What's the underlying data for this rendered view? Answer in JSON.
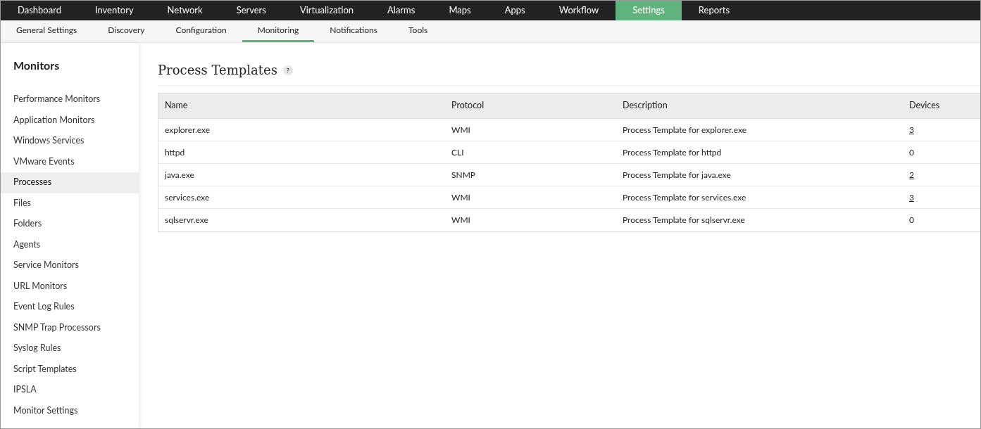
{
  "top_nav": [
    {
      "label": "Dashboard",
      "selected": false
    },
    {
      "label": "Inventory",
      "selected": false
    },
    {
      "label": "Network",
      "selected": false
    },
    {
      "label": "Servers",
      "selected": false
    },
    {
      "label": "Virtualization",
      "selected": false
    },
    {
      "label": "Alarms",
      "selected": false
    },
    {
      "label": "Maps",
      "selected": false
    },
    {
      "label": "Apps",
      "selected": false
    },
    {
      "label": "Workflow",
      "selected": false
    },
    {
      "label": "Settings",
      "selected": true
    },
    {
      "label": "Reports",
      "selected": false
    }
  ],
  "sub_nav": [
    {
      "label": "General Settings",
      "selected": false
    },
    {
      "label": "Discovery",
      "selected": false
    },
    {
      "label": "Configuration",
      "selected": false
    },
    {
      "label": "Monitoring",
      "selected": true
    },
    {
      "label": "Notifications",
      "selected": false
    },
    {
      "label": "Tools",
      "selected": false
    }
  ],
  "sidebar": {
    "title": "Monitors",
    "items": [
      {
        "label": "Performance Monitors",
        "selected": false
      },
      {
        "label": "Application Monitors",
        "selected": false
      },
      {
        "label": "Windows Services",
        "selected": false
      },
      {
        "label": "VMware Events",
        "selected": false
      },
      {
        "label": "Processes",
        "selected": true
      },
      {
        "label": "Files",
        "selected": false
      },
      {
        "label": "Folders",
        "selected": false
      },
      {
        "label": "Agents",
        "selected": false
      },
      {
        "label": "Service Monitors",
        "selected": false
      },
      {
        "label": "URL Monitors",
        "selected": false
      },
      {
        "label": "Event Log Rules",
        "selected": false
      },
      {
        "label": "SNMP Trap Processors",
        "selected": false
      },
      {
        "label": "Syslog Rules",
        "selected": false
      },
      {
        "label": "Script Templates",
        "selected": false
      },
      {
        "label": "IPSLA",
        "selected": false
      },
      {
        "label": "Monitor Settings",
        "selected": false
      }
    ]
  },
  "page": {
    "title": "Process Templates",
    "help": "?"
  },
  "table": {
    "columns": [
      "Name",
      "Protocol",
      "Description",
      "Devices"
    ],
    "rows": [
      {
        "name": "explorer.exe",
        "protocol": "WMI",
        "description": "Process Template for explorer.exe",
        "devices": "3",
        "linked": true
      },
      {
        "name": "httpd",
        "protocol": "CLI",
        "description": "Process Template for httpd",
        "devices": "0",
        "linked": false
      },
      {
        "name": "java.exe",
        "protocol": "SNMP",
        "description": "Process Template for java.exe",
        "devices": "2",
        "linked": true
      },
      {
        "name": "services.exe",
        "protocol": "WMI",
        "description": "Process Template for services.exe",
        "devices": "3",
        "linked": true
      },
      {
        "name": "sqlservr.exe",
        "protocol": "WMI",
        "description": "Process Template for sqlservr.exe",
        "devices": "0",
        "linked": false
      }
    ]
  }
}
